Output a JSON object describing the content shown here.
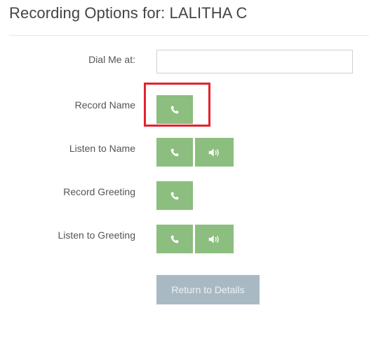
{
  "header": {
    "title": "Recording Options for: LALITHA C"
  },
  "form": {
    "dial_label": "Dial Me at:",
    "dial_value": "",
    "dial_placeholder": "",
    "rows": [
      {
        "label": "Record Name",
        "buttons": [
          "phone-icon"
        ],
        "highlighted": true
      },
      {
        "label": "Listen to Name",
        "buttons": [
          "phone-icon",
          "speaker-icon"
        ],
        "highlighted": false
      },
      {
        "label": "Record Greeting",
        "buttons": [
          "phone-icon"
        ],
        "highlighted": false
      },
      {
        "label": "Listen to Greeting",
        "buttons": [
          "phone-icon",
          "speaker-icon"
        ],
        "highlighted": false
      }
    ],
    "return_label": "Return to Details"
  },
  "colors": {
    "action_button": "#8cbe7f",
    "return_button": "#a9b9c4",
    "highlight_border": "#e5212d",
    "icon": "#ffffff"
  }
}
